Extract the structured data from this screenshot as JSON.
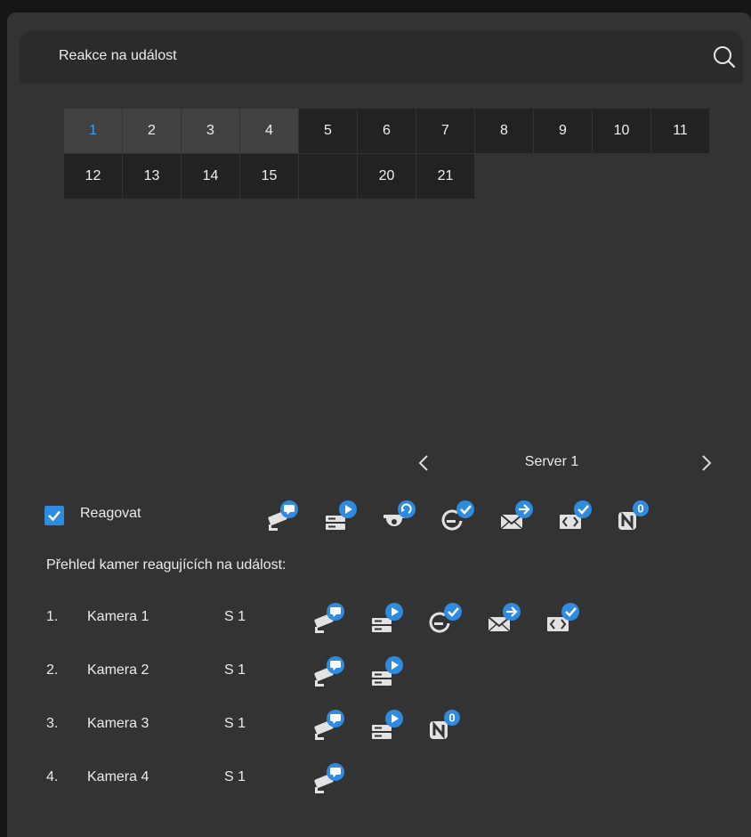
{
  "header": {
    "title": "Reakce na událost"
  },
  "grid": {
    "cells": [
      "1",
      "2",
      "3",
      "4",
      "5",
      "6",
      "7",
      "8",
      "9",
      "10",
      "11",
      "12",
      "13",
      "14",
      "15",
      "",
      "20",
      "21"
    ],
    "highlighted": [
      0,
      1,
      2,
      3
    ],
    "selected_index": 0
  },
  "server": {
    "label": "Server 1"
  },
  "react": {
    "label": "Reagovat",
    "checked": true
  },
  "reaction_icons": [
    "camera-message-icon",
    "recorder-play-icon",
    "dome-camera-rotate-icon",
    "preset-check-icon",
    "email-send-icon",
    "code-check-icon",
    "notification-badge-icon"
  ],
  "notification_count": "0",
  "overview": {
    "title": "Přehled kamer reagujících na událost:"
  },
  "cameras": [
    {
      "index": "1.",
      "name": "Kamera 1",
      "server": "S 1",
      "icons": [
        "camera-message-icon",
        "recorder-play-icon",
        "preset-check-icon",
        "email-send-icon",
        "code-check-icon"
      ]
    },
    {
      "index": "2.",
      "name": "Kamera 2",
      "server": "S 1",
      "icons": [
        "camera-message-icon",
        "recorder-play-icon"
      ]
    },
    {
      "index": "3.",
      "name": "Kamera 3",
      "server": "S 1",
      "icons": [
        "camera-message-icon",
        "recorder-play-icon",
        "notification-badge-icon"
      ]
    },
    {
      "index": "4.",
      "name": "Kamera 4",
      "server": "S 1",
      "icons": [
        "camera-message-icon"
      ]
    }
  ],
  "colors": {
    "accent": "#2e8be0",
    "panel": "#333333",
    "header": "#2b2b2b",
    "cell": "#222222",
    "cell_highlight": "#424242",
    "selected_text": "#3aa0f0"
  }
}
